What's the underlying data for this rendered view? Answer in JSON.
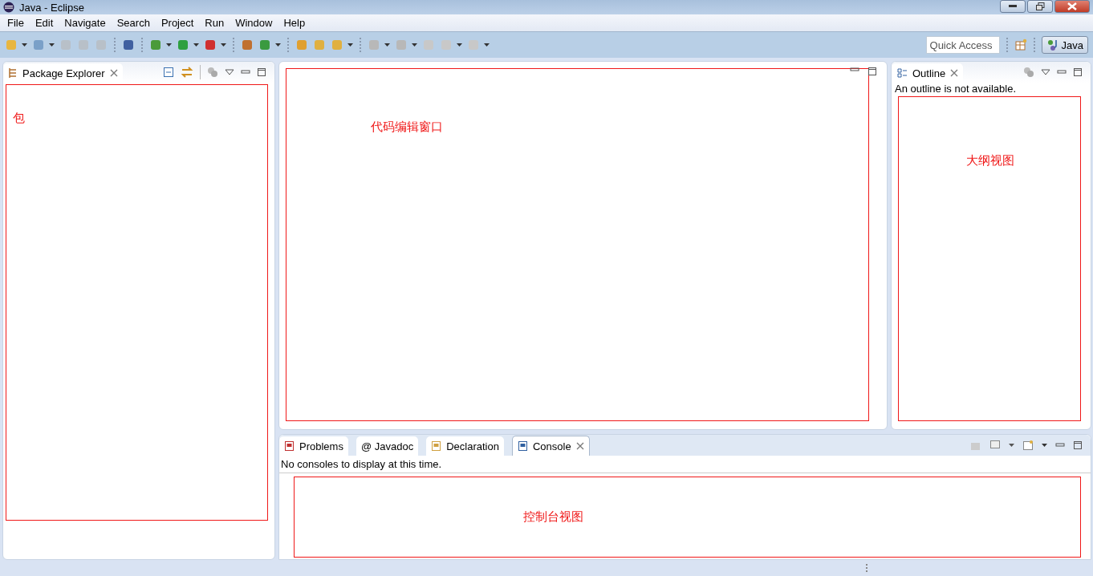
{
  "window": {
    "title": "Java - Eclipse"
  },
  "menu": [
    "File",
    "Edit",
    "Navigate",
    "Search",
    "Project",
    "Run",
    "Window",
    "Help"
  ],
  "toolbar": {
    "quick_access": {
      "placeholder": "Quick Access"
    },
    "perspective": {
      "label": "Java",
      "selected": true
    }
  },
  "package_explorer": {
    "tab": {
      "label": "Package Explorer",
      "selected": false
    },
    "annotation": "包"
  },
  "editor": {
    "annotation": "代码编辑窗口"
  },
  "outline": {
    "tab": {
      "label": "Outline",
      "selected": false
    },
    "message": "An outline is not available.",
    "annotation": "大纲视图"
  },
  "bottom_panel": {
    "tabs": [
      {
        "label": "Problems",
        "selected": false,
        "kind": "problems"
      },
      {
        "label": "@ Javadoc",
        "selected": false,
        "kind": "javadoc"
      },
      {
        "label": "Declaration",
        "selected": false,
        "kind": "declaration"
      },
      {
        "label": "Console",
        "selected": true,
        "kind": "console"
      }
    ],
    "message": "No consoles to display at this time.",
    "annotation": "控制台视图"
  }
}
